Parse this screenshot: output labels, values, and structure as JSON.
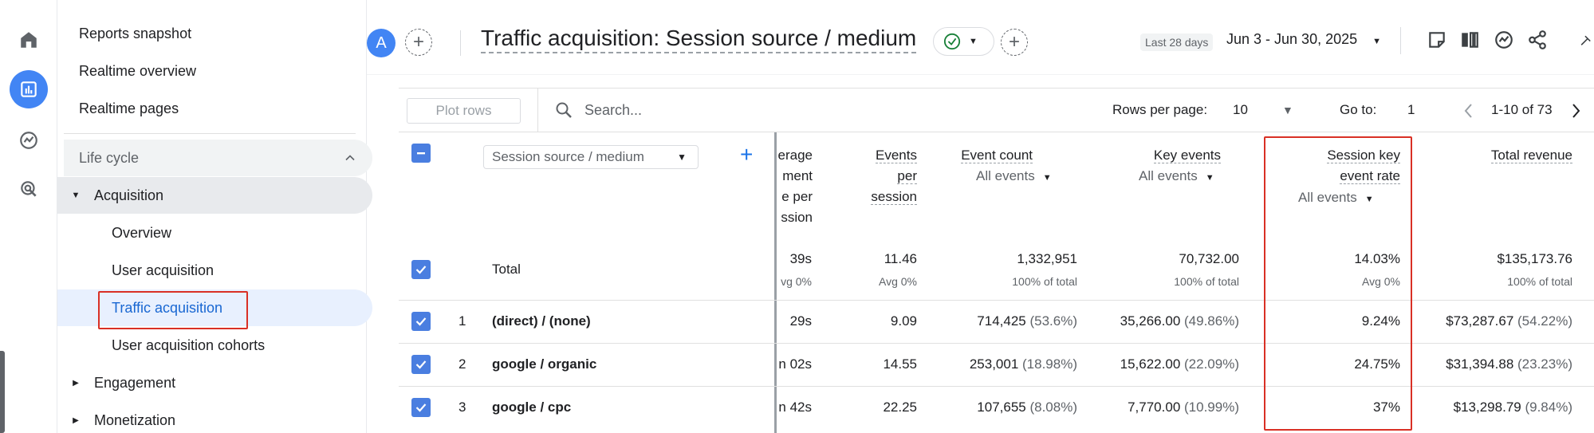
{
  "nav": {
    "top_items": [
      "Reports snapshot",
      "Realtime overview",
      "Realtime pages"
    ],
    "section": "Life cycle",
    "group": "Acquisition",
    "sub_items": [
      "Overview",
      "User acquisition",
      "Traffic acquisition",
      "User acquisition cohorts"
    ],
    "more_groups": [
      "Engagement",
      "Monetization"
    ]
  },
  "header": {
    "avatar": "A",
    "title": "Traffic acquisition: Session source / medium",
    "date_label": "Last 28 days",
    "date_range": "Jun 3 - Jun 30, 2025"
  },
  "toolbar": {
    "plot_rows": "Plot rows",
    "search_placeholder": "Search...",
    "rows_per_page_label": "Rows per page:",
    "rows_per_page": "10",
    "goto_label": "Go to:",
    "goto_value": "1",
    "pagination": "1-10 of 73"
  },
  "table": {
    "dimension": "Session source / medium",
    "columns": {
      "avg_engagement": [
        "erage",
        "ment",
        "e per",
        "ssion"
      ],
      "events_per_session": [
        "Events",
        "per",
        "session"
      ],
      "event_count": "Event count",
      "key_events": "Key events",
      "session_key_event_rate": [
        "Session key",
        "event rate"
      ],
      "total_revenue": "Total revenue"
    },
    "all_events": "All events",
    "total": {
      "label": "Total",
      "avg_engagement": "39s",
      "avg_engagement_sub": "vg 0%",
      "events_per_session": "11.46",
      "events_per_session_sub": "Avg 0%",
      "event_count": "1,332,951",
      "event_count_sub": "100% of total",
      "key_events": "70,732.00",
      "key_events_sub": "100% of total",
      "rate": "14.03%",
      "rate_sub": "Avg 0%",
      "revenue": "$135,173.76",
      "revenue_sub": "100% of total"
    },
    "rows": [
      {
        "num": "1",
        "dim": "(direct) / (none)",
        "avg_engagement": "29s",
        "eps": "9.09",
        "event_count": "714,425",
        "event_count_pct": "(53.6%)",
        "key_events": "35,266.00",
        "key_events_pct": "(49.86%)",
        "rate": "9.24%",
        "revenue": "$73,287.67",
        "revenue_pct": "(54.22%)"
      },
      {
        "num": "2",
        "dim": "google / organic",
        "avg_engagement": "n 02s",
        "eps": "14.55",
        "event_count": "253,001",
        "event_count_pct": "(18.98%)",
        "key_events": "15,622.00",
        "key_events_pct": "(22.09%)",
        "rate": "24.75%",
        "revenue": "$31,394.88",
        "revenue_pct": "(23.23%)"
      },
      {
        "num": "3",
        "dim": "google / cpc",
        "avg_engagement": "n 42s",
        "eps": "22.25",
        "event_count": "107,655",
        "event_count_pct": "(8.08%)",
        "key_events": "7,770.00",
        "key_events_pct": "(10.99%)",
        "rate": "37%",
        "revenue": "$13,298.79",
        "revenue_pct": "(9.84%)"
      }
    ]
  },
  "colors": {
    "accent": "#1a73e8",
    "highlight_box": "#d93025",
    "active_nav_bg": "#e8f0fe",
    "checkbox": "#4a7ee0"
  }
}
